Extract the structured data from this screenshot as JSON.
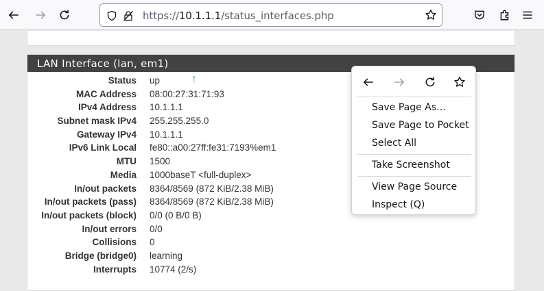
{
  "browser": {
    "url_prefix": "https://",
    "url_host": "10.1.1.1",
    "url_path": "/status_interfaces.php"
  },
  "panel": {
    "title": "LAN Interface (lan, em1)",
    "rows": [
      {
        "label": "Status",
        "value": "up"
      },
      {
        "label": "MAC Address",
        "value": "08:00:27:31:71:93"
      },
      {
        "label": "IPv4 Address",
        "value": "10.1.1.1"
      },
      {
        "label": "Subnet mask IPv4",
        "value": "255.255.255.0"
      },
      {
        "label": "Gateway IPv4",
        "value": "10.1.1.1"
      },
      {
        "label": "IPv6 Link Local",
        "value": "fe80::a00:27ff:fe31:7193%em1"
      },
      {
        "label": "MTU",
        "value": "1500"
      },
      {
        "label": "Media",
        "value": "1000baseT <full-duplex>"
      },
      {
        "label": "In/out packets",
        "value": "8364/8569 (872 KiB/2.38 MiB)"
      },
      {
        "label": "In/out packets (pass)",
        "value": "8364/8569 (872 KiB/2.38 MiB)"
      },
      {
        "label": "In/out packets (block)",
        "value": "0/0 (0 B/0 B)"
      },
      {
        "label": "In/out errors",
        "value": "0/0"
      },
      {
        "label": "Collisions",
        "value": "0"
      },
      {
        "label": "Bridge (bridge0)",
        "value": "learning"
      },
      {
        "label": "Interrupts",
        "value": "10774 (2/s)"
      }
    ]
  },
  "context_menu": {
    "items": {
      "save_page_as": "Save Page As…",
      "save_to_pocket": "Save Page to Pocket",
      "select_all": "Select All",
      "take_screenshot": "Take Screenshot",
      "view_source": "View Page Source",
      "inspect": "Inspect (Q)"
    }
  },
  "colors": {
    "panel_heading": "#424242",
    "status_up": "#3fa34d"
  }
}
